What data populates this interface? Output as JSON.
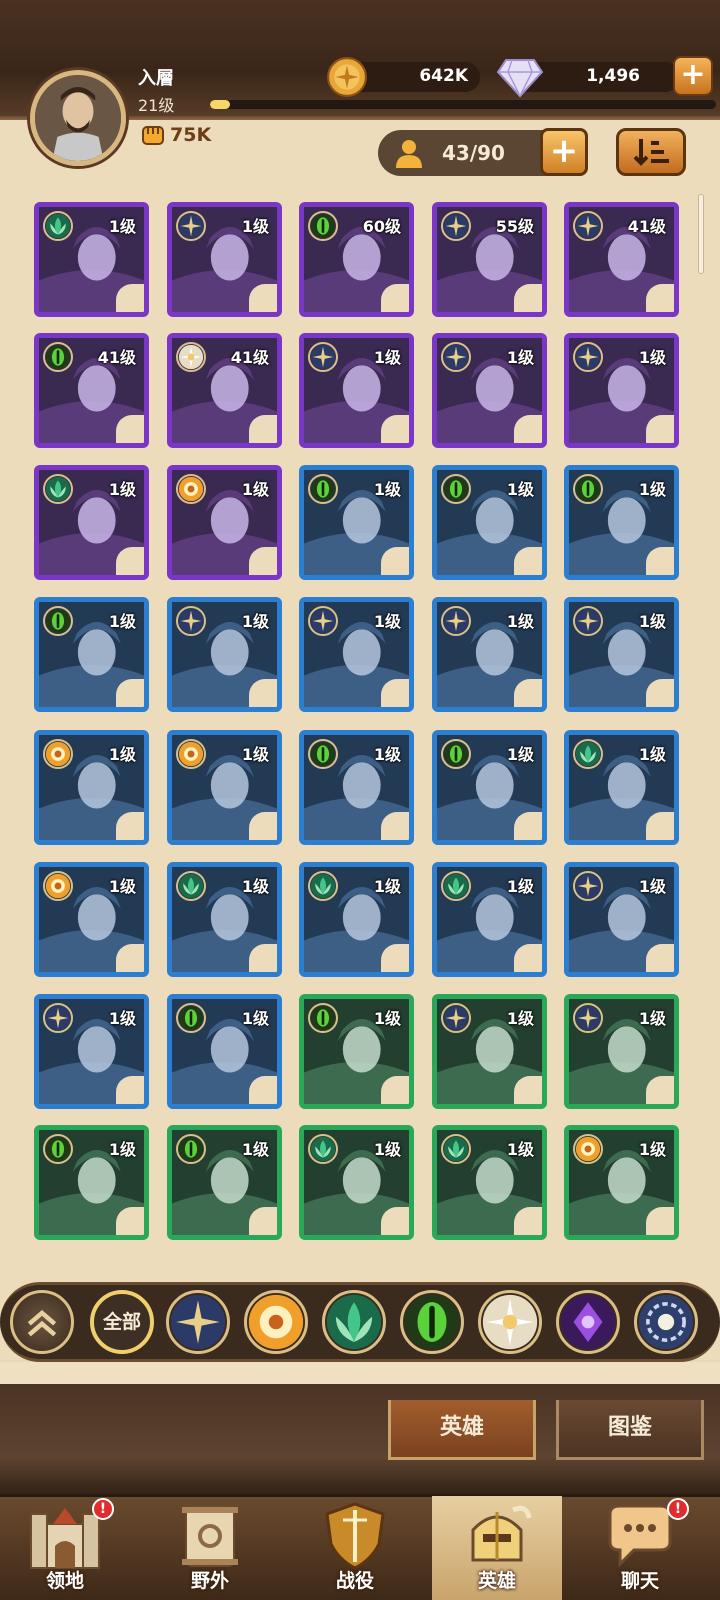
{
  "player": {
    "name": "入層",
    "level": "21级",
    "xp_fraction": 0.04,
    "power": "75K",
    "gold": "642K",
    "gems": "1,496"
  },
  "roster": {
    "count": "43/90"
  },
  "heroes": [
    {
      "level": "1级",
      "rarity": "purple",
      "faction": "forest"
    },
    {
      "level": "1级",
      "rarity": "purple",
      "faction": "light"
    },
    {
      "level": "60级",
      "rarity": "purple",
      "faction": "eye"
    },
    {
      "level": "55级",
      "rarity": "purple",
      "faction": "light"
    },
    {
      "level": "41级",
      "rarity": "purple",
      "faction": "light"
    },
    {
      "level": "41级",
      "rarity": "purple",
      "faction": "eye"
    },
    {
      "level": "41级",
      "rarity": "purple",
      "faction": "celestial"
    },
    {
      "level": "1级",
      "rarity": "purple",
      "faction": "light"
    },
    {
      "level": "1级",
      "rarity": "purple",
      "faction": "light"
    },
    {
      "level": "1级",
      "rarity": "purple",
      "faction": "light"
    },
    {
      "level": "1级",
      "rarity": "purple",
      "faction": "forest"
    },
    {
      "level": "1级",
      "rarity": "purple",
      "faction": "sun"
    },
    {
      "level": "1级",
      "rarity": "blue",
      "faction": "eye"
    },
    {
      "level": "1级",
      "rarity": "blue",
      "faction": "eye"
    },
    {
      "level": "1级",
      "rarity": "blue",
      "faction": "eye"
    },
    {
      "level": "1级",
      "rarity": "blue",
      "faction": "eye"
    },
    {
      "level": "1级",
      "rarity": "blue",
      "faction": "light"
    },
    {
      "level": "1级",
      "rarity": "blue",
      "faction": "light"
    },
    {
      "level": "1级",
      "rarity": "blue",
      "faction": "light"
    },
    {
      "level": "1级",
      "rarity": "blue",
      "faction": "light"
    },
    {
      "level": "1级",
      "rarity": "blue",
      "faction": "sun"
    },
    {
      "level": "1级",
      "rarity": "blue",
      "faction": "sun"
    },
    {
      "level": "1级",
      "rarity": "blue",
      "faction": "eye"
    },
    {
      "level": "1级",
      "rarity": "blue",
      "faction": "eye"
    },
    {
      "level": "1级",
      "rarity": "blue",
      "faction": "forest"
    },
    {
      "level": "1级",
      "rarity": "blue",
      "faction": "sun"
    },
    {
      "level": "1级",
      "rarity": "blue",
      "faction": "forest"
    },
    {
      "level": "1级",
      "rarity": "blue",
      "faction": "forest"
    },
    {
      "level": "1级",
      "rarity": "blue",
      "faction": "forest"
    },
    {
      "level": "1级",
      "rarity": "blue",
      "faction": "light"
    },
    {
      "level": "1级",
      "rarity": "blue",
      "faction": "light"
    },
    {
      "level": "1级",
      "rarity": "blue",
      "faction": "eye"
    },
    {
      "level": "1级",
      "rarity": "green",
      "faction": "eye"
    },
    {
      "level": "1级",
      "rarity": "green",
      "faction": "light"
    },
    {
      "level": "1级",
      "rarity": "green",
      "faction": "light"
    },
    {
      "level": "1级",
      "rarity": "green",
      "faction": "eye"
    },
    {
      "level": "1级",
      "rarity": "green",
      "faction": "eye"
    },
    {
      "level": "1级",
      "rarity": "green",
      "faction": "forest"
    },
    {
      "level": "1级",
      "rarity": "green",
      "faction": "forest"
    },
    {
      "level": "1级",
      "rarity": "green",
      "faction": "sun"
    }
  ],
  "filters": {
    "all_label": "全部",
    "factions": [
      "light-faction-icon",
      "sun-faction-icon",
      "forest-faction-icon",
      "eye-faction-icon",
      "celestial-faction-icon",
      "hypogean-faction-icon",
      "dimensional-faction-icon"
    ]
  },
  "tabs": {
    "heroes": "英雄",
    "codex": "图鉴"
  },
  "nav": [
    {
      "label": "领地",
      "icon": "castle-icon",
      "badge": "!"
    },
    {
      "label": "野外",
      "icon": "map-scroll-icon",
      "badge": ""
    },
    {
      "label": "战役",
      "icon": "sword-shield-icon",
      "badge": ""
    },
    {
      "label": "英雄",
      "icon": "helmet-icon",
      "badge": "",
      "active": true
    },
    {
      "label": "聊天",
      "icon": "chat-bubble-icon",
      "badge": "!"
    }
  ],
  "colors": {
    "purple": "#7a37c7",
    "blue": "#2b7ed0",
    "green": "#29a85a",
    "light": "#e9d08a",
    "sun": "#f0a02a",
    "forest": "#44c58a",
    "eye": "#5bd23a",
    "celestial": "#f4efe0"
  }
}
